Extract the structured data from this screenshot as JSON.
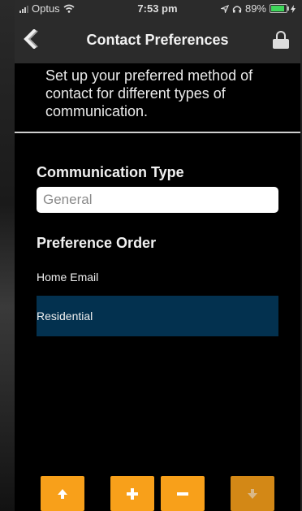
{
  "status_bar": {
    "carrier": "Optus",
    "time": "7:53 pm",
    "battery": "89%",
    "battery_level": 0.89
  },
  "nav": {
    "title": "Contact Preferences",
    "back_icon": "chevron-left-icon",
    "lock_icon": "lock-icon"
  },
  "intro_text": "Set up your preferred method of contact for different types of communication.",
  "communication_type": {
    "label": "Communication Type",
    "value": "General"
  },
  "preference_order": {
    "label": "Preference Order",
    "items": [
      "Home Email",
      "Residential"
    ],
    "selected_index": 1
  },
  "toolbar": {
    "up_icon": "arrow-up-icon",
    "add_icon": "plus-icon",
    "remove_icon": "minus-icon",
    "down_icon": "arrow-down-icon"
  },
  "colors": {
    "accent_button": "#f8a01a",
    "selected_row": "#03314f",
    "bar_background": "#2b2b2b"
  }
}
